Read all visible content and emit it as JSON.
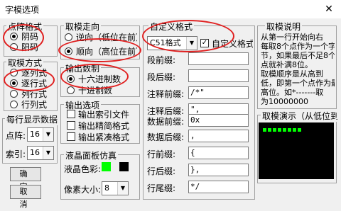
{
  "window": {
    "title": "字模选项",
    "close_symbol": "✕"
  },
  "dot_format": {
    "label": "点阵格式",
    "options": [
      "阴码",
      "阳码"
    ],
    "selected": "阴码"
  },
  "take_mode": {
    "label": "取模方式",
    "options": [
      "逐列式",
      "逐行式",
      "列行式",
      "行列式"
    ],
    "selected": "逐行式"
  },
  "per_line": {
    "label": "每行显示数据",
    "dot_label": "点阵:",
    "dot_value": "16",
    "index_label": "索引:",
    "index_value": "16"
  },
  "buttons": {
    "ok": "确 定",
    "cancel": "取 消"
  },
  "direction": {
    "label": "取模走向",
    "options": [
      "逆向（低位在前）",
      "顺向（高位在前）"
    ],
    "selected": "顺向（高位在前）"
  },
  "radix": {
    "label": "输出数制",
    "options": [
      "十六进制数",
      "十进制数"
    ],
    "selected": "十六进制数"
  },
  "output": {
    "label": "输出选项",
    "options": [
      "输出索引文件",
      "输出精简格式",
      "输出紧凑格式"
    ]
  },
  "lcd": {
    "label": "液晶面板仿真",
    "color_label": "液晶色彩:",
    "pixel_label": "像素大小:",
    "pixel_value": "8",
    "on_color": "#00ff00",
    "off_color": "#000000"
  },
  "custom": {
    "label": "自定义格式",
    "format_value": "C51格式",
    "custom_check_label": "自定义格式",
    "fields": [
      {
        "label": "段前缀:",
        "value": ""
      },
      {
        "label": "段后缀:",
        "value": ""
      },
      {
        "label": "注释前缀:",
        "value": "/*\""
      },
      {
        "label": "注释后缀:",
        "value": "\","
      },
      {
        "label": "数据前缀:",
        "value": "0x"
      },
      {
        "label": "数据后缀:",
        "value": ","
      },
      {
        "label": "行前缀:",
        "value": "{"
      },
      {
        "label": "行后缀:",
        "value": "},"
      },
      {
        "label": "行尾缀:",
        "value": "*/"
      }
    ]
  },
  "explain": {
    "label": "取模说明",
    "lines": [
      "从第一行开始向右",
      "每取8个点作为一个字",
      "节，如果最后不足8个",
      "点就补满8位。",
      "取模顺序是从高到",
      "低，即第一个点作为最",
      "高位。如*-------取",
      "为10000000"
    ]
  },
  "demo": {
    "label": "取模演示（从低位到"
  },
  "highlight_color": "#e02020"
}
